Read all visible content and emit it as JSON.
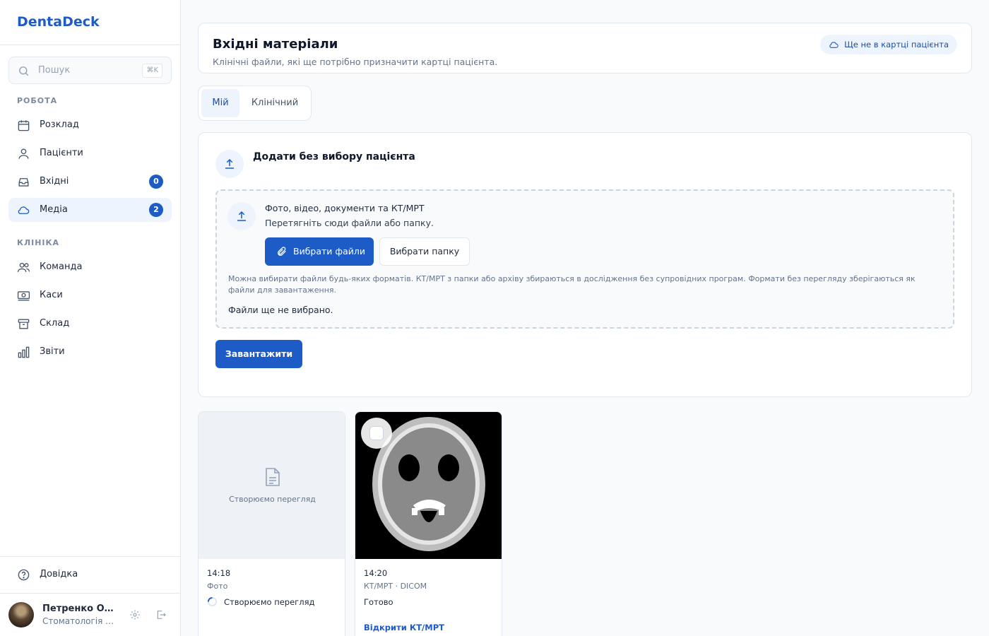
{
  "app": {
    "name": "DentaDeck"
  },
  "search": {
    "placeholder": "Пошук",
    "shortcut": "⌘K"
  },
  "sidebar": {
    "sections": [
      {
        "title": "РОБОТА"
      },
      {
        "title": "КЛІНІКА"
      }
    ],
    "work_items": [
      {
        "label": "Розклад",
        "icon": "calendar-icon"
      },
      {
        "label": "Пацієнти",
        "icon": "patients-icon"
      },
      {
        "label": "Вхідні",
        "icon": "inbox-icon",
        "badge": "0"
      },
      {
        "label": "Медіа",
        "icon": "cloud-icon",
        "badge": "2",
        "active": true
      }
    ],
    "clinic_items": [
      {
        "label": "Команда",
        "icon": "team-icon"
      },
      {
        "label": "Каси",
        "icon": "cash-icon"
      },
      {
        "label": "Склад",
        "icon": "archive-icon"
      },
      {
        "label": "Звіти",
        "icon": "reports-icon"
      }
    ],
    "help": "Довідка",
    "user": {
      "name": "Петренко Ол...",
      "org": "Стоматологія П..."
    }
  },
  "header": {
    "title": "Вхідні матеріали",
    "subtitle": "Клінічні файли, які ще потрібно призначити картці пацієнта.",
    "pill": "Ще не в картці пацієнта"
  },
  "tabs": [
    {
      "label": "Мій",
      "active": true
    },
    {
      "label": "Клінічний",
      "active": false
    }
  ],
  "upload": {
    "title": "Додати без вибору пацієнта",
    "dropzone_title": "Фото, відео, документи та КТ/МРТ",
    "dropzone_sub": "Перетягніть сюди файли або папку.",
    "choose_files": "Вибрати файли",
    "choose_folder": "Вибрати папку",
    "note": "Можна вибирати файли будь-яких форматів. КТ/МРТ з папки або архіву збираються в дослідження без супровідних програм. Формати без перегляду зберігаються як файли для завантаження.",
    "status": "Файли ще не вибрано.",
    "submit": "Завантажити"
  },
  "media": [
    {
      "placeholder": "Створюємо перегляд",
      "time": "14:18",
      "type": "Фото",
      "status": "Створюємо перегляд"
    },
    {
      "time": "14:20",
      "type": "КТ/МРТ · DICOM",
      "status": "Готово",
      "link": "Відкрити КТ/МРТ"
    }
  ],
  "colors": {
    "accent": "#1d5bc7",
    "active_bg": "#eef4fd",
    "border": "#e2e8f0"
  }
}
